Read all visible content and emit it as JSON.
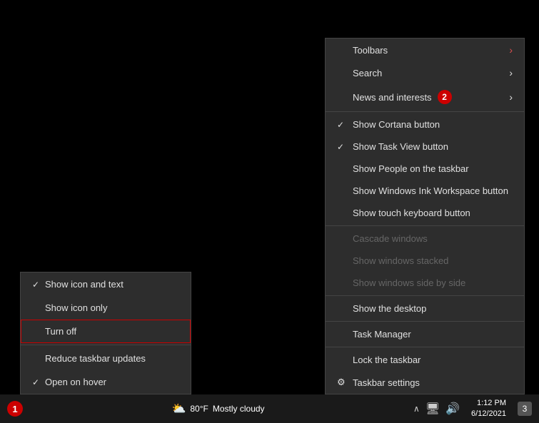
{
  "taskbar": {
    "badge1": "1",
    "badge2": "3",
    "weather_temp": "80°F",
    "weather_desc": "Mostly cloudy",
    "time": "1:12 PM",
    "date": "6/12/2021"
  },
  "main_menu": {
    "items": [
      {
        "id": "toolbars",
        "label": "Toolbars",
        "has_chevron": true,
        "chevron_color": "red",
        "disabled": false
      },
      {
        "id": "search",
        "label": "Search",
        "has_chevron": true,
        "chevron_color": "white",
        "disabled": false
      },
      {
        "id": "news",
        "label": "News and interests",
        "has_chevron": true,
        "chevron_color": "white",
        "badge": "2",
        "disabled": false
      },
      {
        "id": "cortana",
        "label": "Show Cortana button",
        "checked": true,
        "disabled": false
      },
      {
        "id": "taskview",
        "label": "Show Task View button",
        "checked": true,
        "disabled": false
      },
      {
        "id": "people",
        "label": "Show People on the taskbar",
        "checked": false,
        "disabled": false
      },
      {
        "id": "ink",
        "label": "Show Windows Ink Workspace button",
        "checked": false,
        "disabled": false
      },
      {
        "id": "touch",
        "label": "Show touch keyboard button",
        "checked": false,
        "disabled": false
      },
      {
        "id": "sep1",
        "separator": true
      },
      {
        "id": "cascade",
        "label": "Cascade windows",
        "disabled": true
      },
      {
        "id": "stacked",
        "label": "Show windows stacked",
        "disabled": true
      },
      {
        "id": "sidebyside",
        "label": "Show windows side by side",
        "disabled": true
      },
      {
        "id": "sep2",
        "separator": true
      },
      {
        "id": "desktop",
        "label": "Show the desktop",
        "disabled": false
      },
      {
        "id": "sep3",
        "separator": true
      },
      {
        "id": "taskmanager",
        "label": "Task Manager",
        "disabled": false
      },
      {
        "id": "sep4",
        "separator": true
      },
      {
        "id": "lock",
        "label": "Lock the taskbar",
        "disabled": false
      },
      {
        "id": "settings",
        "label": "Taskbar settings",
        "has_gear": true,
        "disabled": false
      }
    ]
  },
  "sub_menu": {
    "items": [
      {
        "id": "show-icon-text",
        "label": "Show icon and text",
        "checked": true
      },
      {
        "id": "show-icon-only",
        "label": "Show icon only",
        "checked": false
      },
      {
        "id": "turn-off",
        "label": "Turn off",
        "checked": false,
        "active_border": true
      },
      {
        "id": "sep",
        "separator": true
      },
      {
        "id": "reduce",
        "label": "Reduce taskbar updates",
        "checked": false
      },
      {
        "id": "hover",
        "label": "Open on hover",
        "checked": true
      }
    ]
  }
}
